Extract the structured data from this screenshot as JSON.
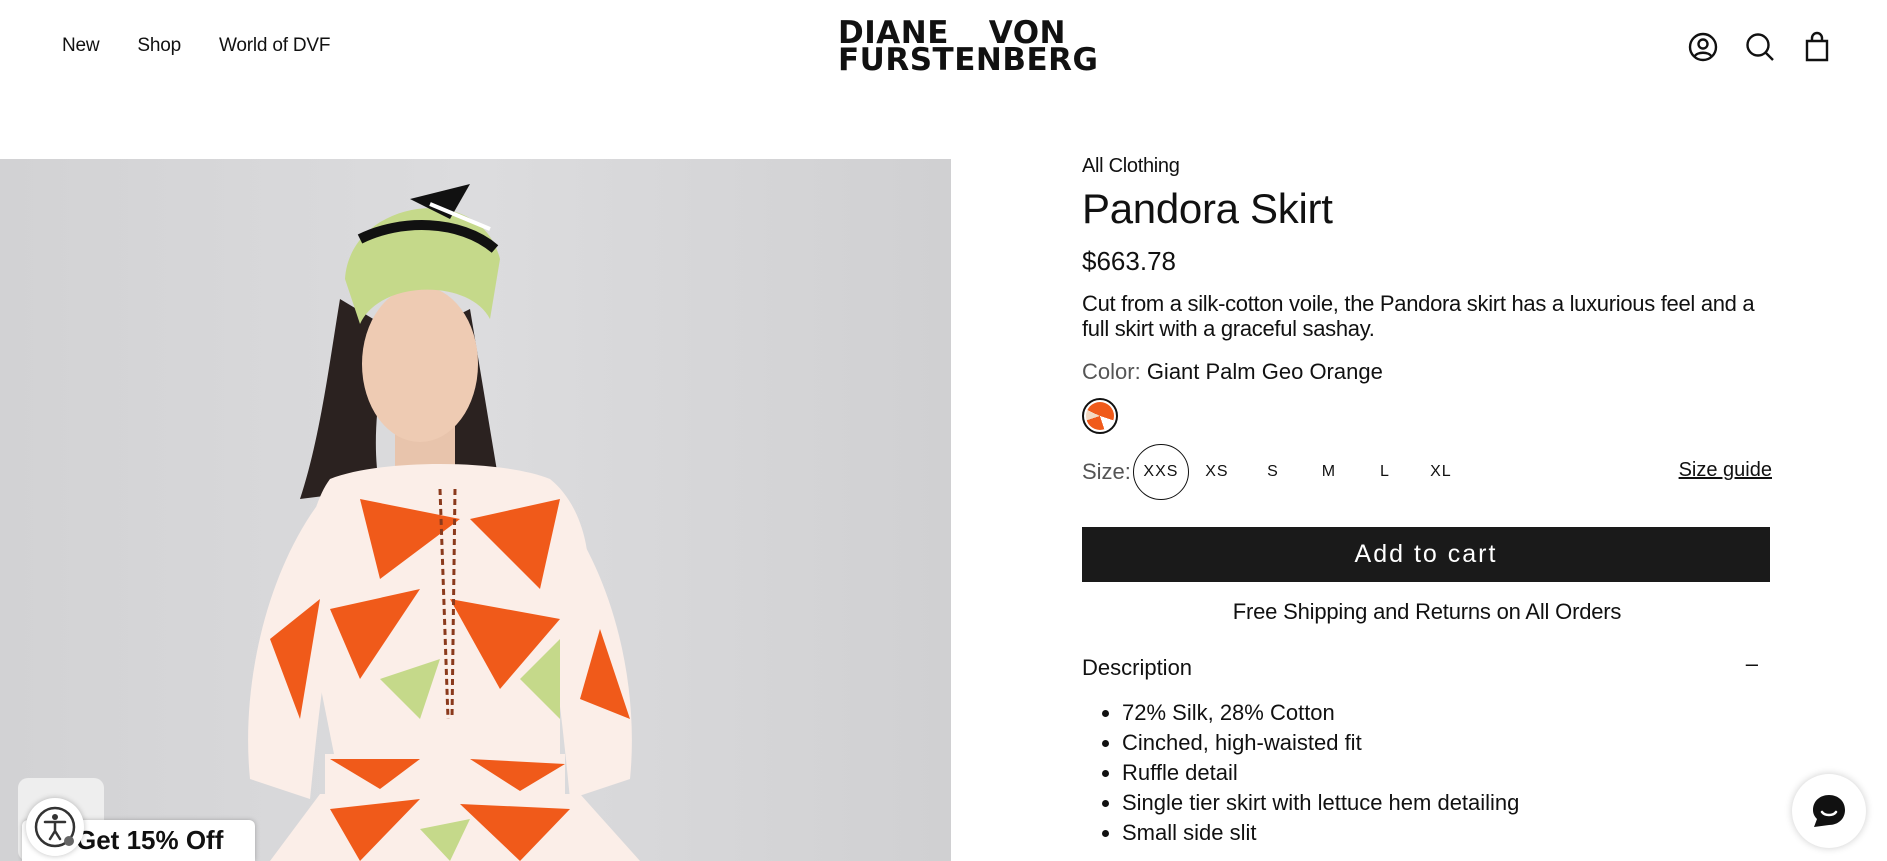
{
  "header": {
    "nav": [
      "New",
      "Shop",
      "World of DVF"
    ],
    "logo_line1_left": "DIANE",
    "logo_line1_right": "VON",
    "logo_line2": "FURSTENBERG",
    "icons": [
      "account-icon",
      "search-icon",
      "bag-icon"
    ]
  },
  "product": {
    "breadcrumb": "All Clothing",
    "title": "Pandora Skirt",
    "price": "$663.78",
    "description": "Cut from a silk-cotton voile, the Pandora skirt has a luxurious feel and a full skirt with a graceful sashay.",
    "color_label": "Color:",
    "color_value": "Giant Palm Geo Orange",
    "size_label": "Size:",
    "sizes": [
      "XXS",
      "XS",
      "S",
      "M",
      "L",
      "XL"
    ],
    "selected_size": "XXS",
    "size_guide": "Size guide",
    "add_to_cart": "Add to cart",
    "shipping": "Free Shipping and Returns on All Orders",
    "description_heading": "Description",
    "description_toggle": "–",
    "details": [
      "72% Silk, 28% Cotton",
      "Cinched, high-waisted fit",
      "Ruffle detail",
      "Single tier skirt with lettuce hem detailing",
      "Small side slit"
    ]
  },
  "overlays": {
    "promo": "Get 15% Off"
  },
  "colors": {
    "accent_orange": "#f05a1a",
    "button_bg": "#1a1a1a",
    "image_bg": "#d6d6d8"
  }
}
